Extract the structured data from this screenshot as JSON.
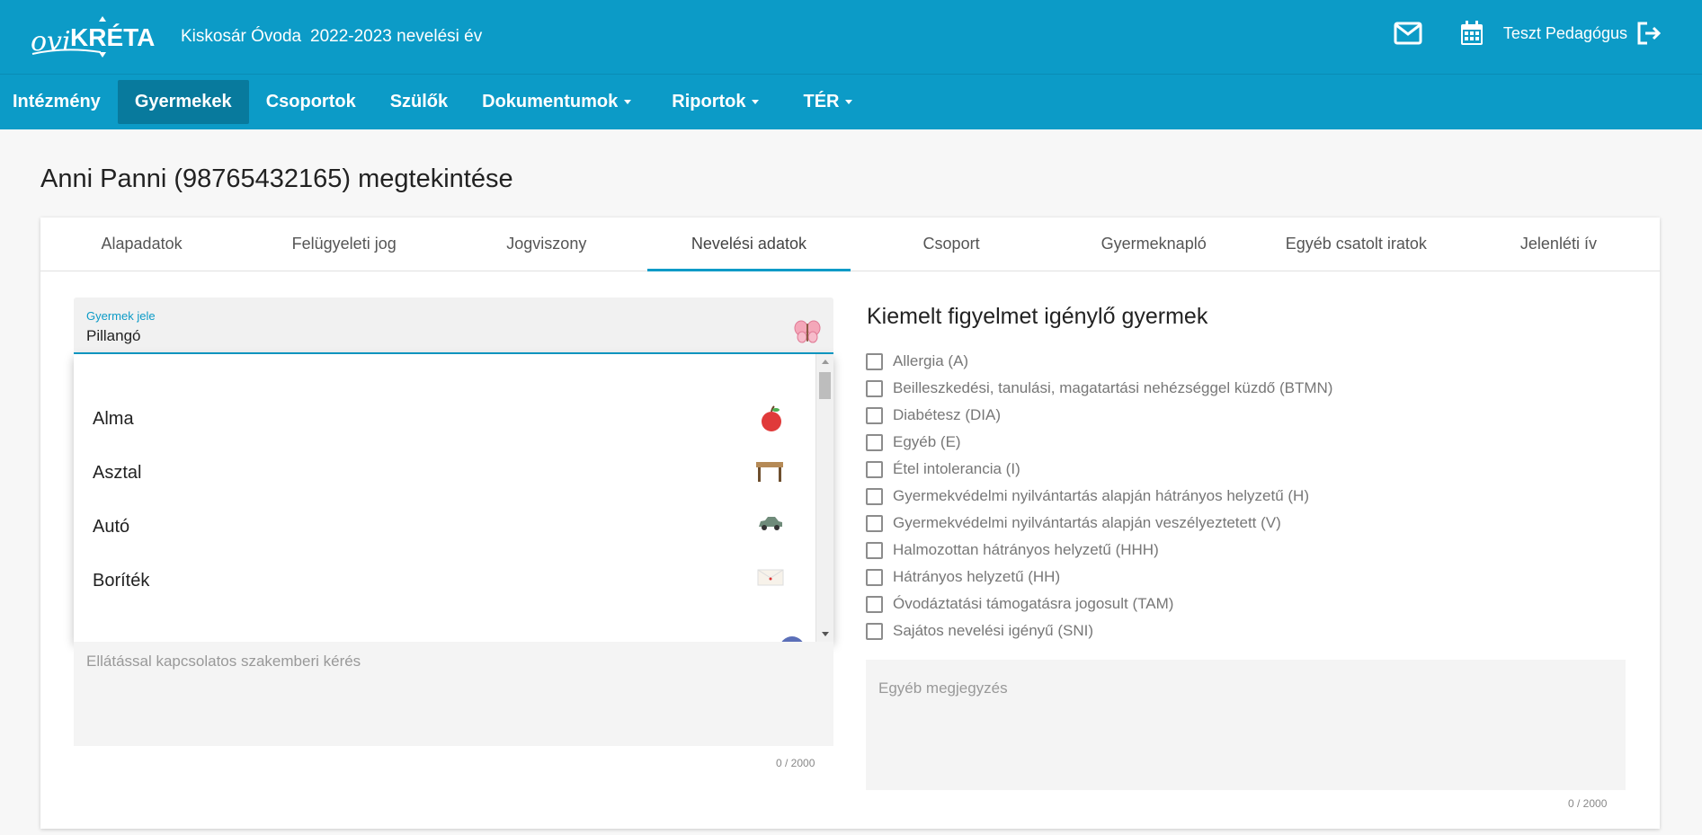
{
  "header": {
    "institution": "Kiskosár Óvoda",
    "school_year": "2022-2023 nevelési év",
    "user_name": "Teszt Pedagógus",
    "icons": [
      "mail-icon",
      "calendar-icon",
      "logout-icon"
    ]
  },
  "nav": {
    "items": [
      {
        "label": "Intézmény",
        "dropdown": false
      },
      {
        "label": "Gyermekek",
        "dropdown": false,
        "active": true
      },
      {
        "label": "Csoportok",
        "dropdown": false
      },
      {
        "label": "Szülők",
        "dropdown": false
      },
      {
        "label": "Dokumentumok",
        "dropdown": true
      },
      {
        "label": "Riportok",
        "dropdown": true
      },
      {
        "label": "TÉR",
        "dropdown": true
      }
    ]
  },
  "page": {
    "title": "Anni Panni (98765432165) megtekintése"
  },
  "tabs": [
    {
      "label": "Alapadatok"
    },
    {
      "label": "Felügyeleti jog"
    },
    {
      "label": "Jogviszony"
    },
    {
      "label": "Nevelési adatok",
      "active": true
    },
    {
      "label": "Csoport"
    },
    {
      "label": "Gyermeknapló"
    },
    {
      "label": "Egyéb csatolt iratok"
    },
    {
      "label": "Jelenléti ív"
    }
  ],
  "symbol_field": {
    "label": "Gyermek jele",
    "value": "Pillangó",
    "icon": "butterfly-icon"
  },
  "symbol_options": [
    {
      "label": "Alma",
      "icon": "apple-icon"
    },
    {
      "label": "Asztal",
      "icon": "table-icon"
    },
    {
      "label": "Autó",
      "icon": "car-icon"
    },
    {
      "label": "Boríték",
      "icon": "envelope-icon"
    }
  ],
  "care_request": {
    "placeholder": "Ellátással kapcsolatos szakemberi kérés",
    "counter": "0 / 2000"
  },
  "special_attention": {
    "title": "Kiemelt figyelmet igénylő gyermek",
    "items": [
      {
        "label": "Allergia (A)",
        "checked": false
      },
      {
        "label": "Beilleszkedési, tanulási, magatartási nehézséggel küzdő (BTMN)",
        "checked": false
      },
      {
        "label": "Diabétesz (DIA)",
        "checked": false
      },
      {
        "label": "Egyéb (E)",
        "checked": false
      },
      {
        "label": "Étel intolerancia (I)",
        "checked": false
      },
      {
        "label": "Gyermekvédelmi nyilvántartás alapján hátrányos helyzetű (H)",
        "checked": false
      },
      {
        "label": "Gyermekvédelmi nyilvántartás alapján veszélyeztetett (V)",
        "checked": false
      },
      {
        "label": "Halmozottan hátrányos helyzetű (HHH)",
        "checked": false
      },
      {
        "label": "Hátrányos helyzetű (HH)",
        "checked": false
      },
      {
        "label": "Óvodáztatási támogatásra jogosult (TAM)",
        "checked": false
      },
      {
        "label": "Sajátos nevelési igényű (SNI)",
        "checked": false
      }
    ]
  },
  "other_note": {
    "placeholder": "Egyéb megjegyzés",
    "counter": "0 / 2000"
  },
  "colors": {
    "brand": "#0c9bc7",
    "nav_active": "#087a9d"
  }
}
